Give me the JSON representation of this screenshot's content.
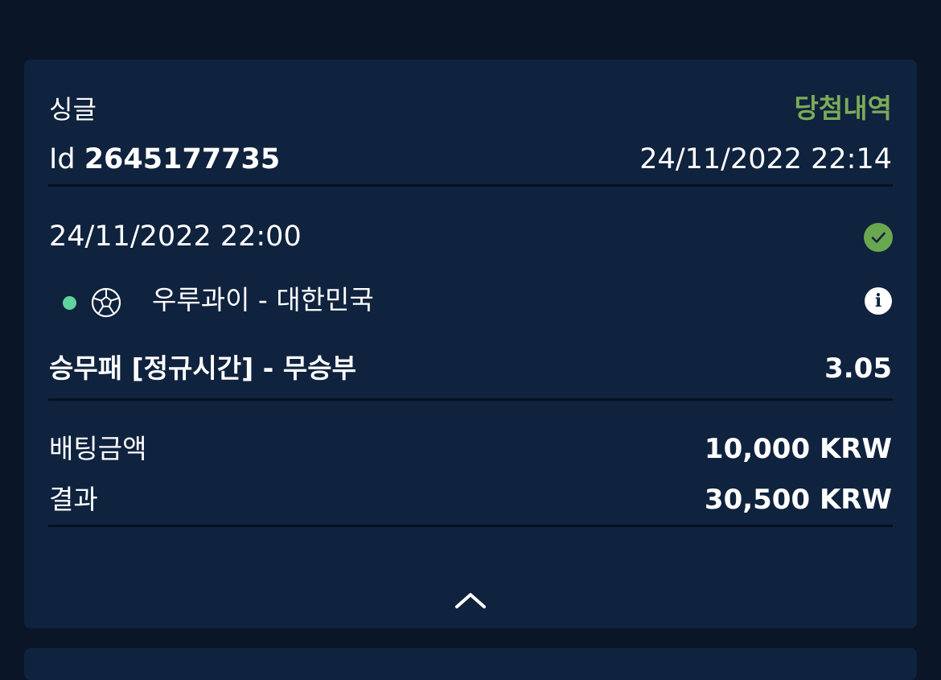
{
  "bet": {
    "type": "싱글",
    "status": "당첨내역",
    "id_label": "Id",
    "id_value": "2645177735",
    "placed_at": "24/11/2022 22:14"
  },
  "event": {
    "time": "24/11/2022 22:00",
    "status_icon": "check-circle-icon",
    "sport_icon": "soccer-ball-icon",
    "live_indicator": "green-dot",
    "match": "우루과이 - 대한민국",
    "info_icon": "info-icon",
    "market": "승무패 [정규시간] - 무승부",
    "odds": "3.05"
  },
  "summary": {
    "stake_label": "배팅금액",
    "stake_value": "10,000 KRW",
    "result_label": "결과",
    "result_value": "30,500 KRW"
  },
  "controls": {
    "collapse_icon": "chevron-up-icon"
  },
  "colors": {
    "background": "#0a1628",
    "card": "#0f223e",
    "win_green": "#7bab58",
    "check_green": "#6aa84f",
    "live_dot": "#5fd39b",
    "text": "#ffffff"
  }
}
